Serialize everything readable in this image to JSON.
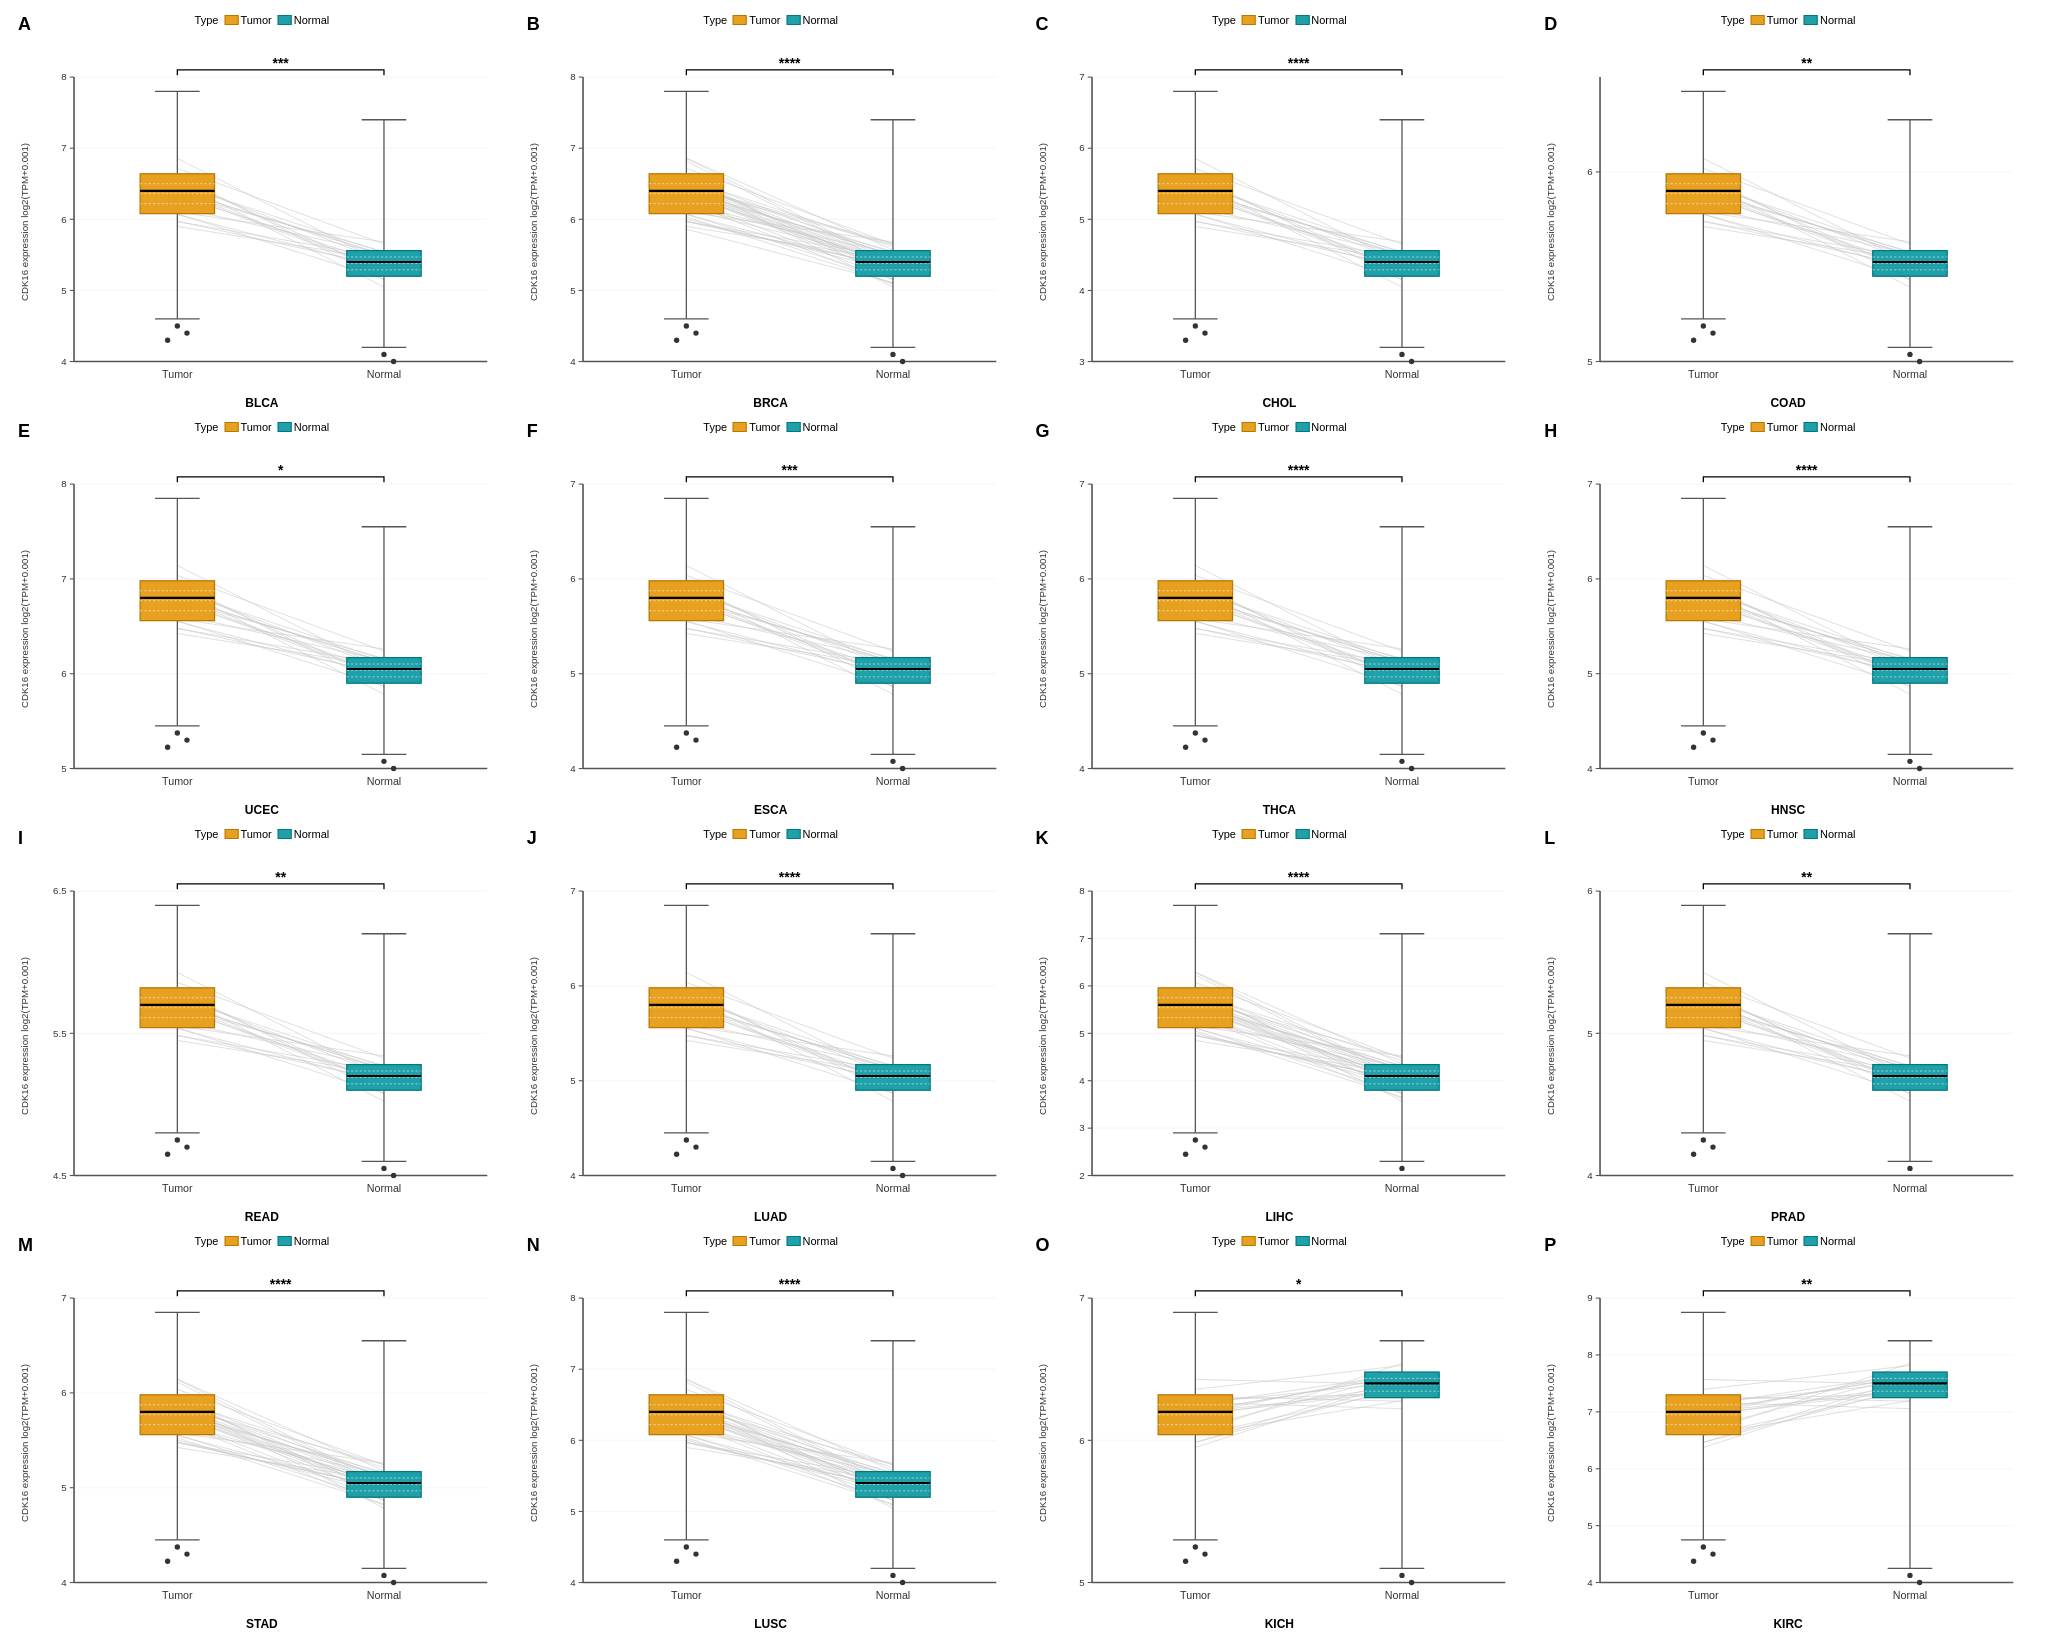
{
  "panels": [
    {
      "id": "A",
      "cancer": "BLCA",
      "sig": "***",
      "tumorY": 130,
      "normalY": 230,
      "yMin": 4,
      "yMax": 8
    },
    {
      "id": "B",
      "cancer": "BRCA",
      "sig": "****",
      "tumorY": 120,
      "normalY": 220,
      "yMin": 4,
      "yMax": 8
    },
    {
      "id": "C",
      "cancer": "CHOL",
      "sig": "****",
      "tumorY": 100,
      "normalY": 280,
      "yMin": 3,
      "yMax": 7
    },
    {
      "id": "D",
      "cancer": "COAD",
      "sig": "**",
      "tumorY": 130,
      "normalY": 160,
      "yMin": 5,
      "yMax": 6.5
    },
    {
      "id": "E",
      "cancer": "UCEC",
      "sig": "*",
      "tumorY": 140,
      "normalY": 250,
      "yMin": 5,
      "yMax": 8
    },
    {
      "id": "F",
      "cancer": "ESCA",
      "sig": "***",
      "tumorY": 80,
      "normalY": 200,
      "yMin": 4,
      "yMax": 7
    },
    {
      "id": "G",
      "cancer": "THCA",
      "sig": "****",
      "tumorY": 130,
      "normalY": 170,
      "yMin": 4,
      "yMax": 7
    },
    {
      "id": "H",
      "cancer": "HNSC",
      "sig": "****",
      "tumorY": 120,
      "normalY": 200,
      "yMin": 4,
      "yMax": 7
    },
    {
      "id": "I",
      "cancer": "READ",
      "sig": "**",
      "tumorY": 100,
      "normalY": 210,
      "yMin": 4.5,
      "yMax": 6.5
    },
    {
      "id": "J",
      "cancer": "LUAD",
      "sig": "****",
      "tumorY": 120,
      "normalY": 200,
      "yMin": 4,
      "yMax": 7
    },
    {
      "id": "K",
      "cancer": "LIHC",
      "sig": "****",
      "tumorY": 160,
      "normalY": 270,
      "yMin": 2,
      "yMax": 8
    },
    {
      "id": "L",
      "cancer": "PRAD",
      "sig": "**",
      "tumorY": 140,
      "normalY": 160,
      "yMin": 4,
      "yMax": 6
    },
    {
      "id": "M",
      "cancer": "STAD",
      "sig": "****",
      "tumorY": 110,
      "normalY": 230,
      "yMin": 4,
      "yMax": 7
    },
    {
      "id": "N",
      "cancer": "LUSC",
      "sig": "****",
      "tumorY": 120,
      "normalY": 220,
      "yMin": 4,
      "yMax": 8
    },
    {
      "id": "O",
      "cancer": "KICH",
      "sig": "*",
      "tumorY": 130,
      "normalY": 150,
      "yMin": 5,
      "yMax": 7
    },
    {
      "id": "P",
      "cancer": "KIRC",
      "sig": "**",
      "tumorY": 190,
      "normalY": 160,
      "yMin": 4,
      "yMax": 9
    }
  ],
  "legend": {
    "type_label": "Type",
    "tumor_label": "Tumor",
    "normal_label": "Normal"
  },
  "yAxisLabel": "CDK16 expression log2(TPM+0.001)"
}
